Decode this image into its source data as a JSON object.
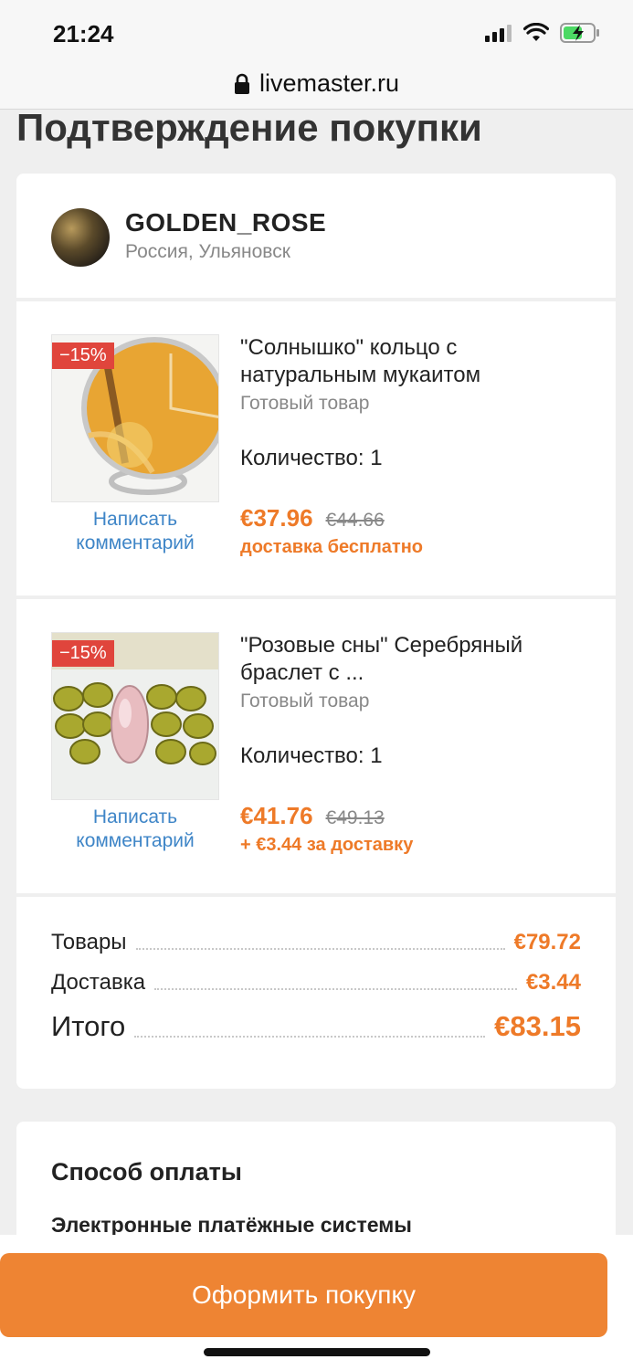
{
  "status": {
    "time": "21:24"
  },
  "browser": {
    "url": "livemaster.ru"
  },
  "page": {
    "title": "Подтверждение покупки"
  },
  "seller": {
    "name": "GOLDEN_ROSE",
    "location": "Россия, Ульяновск"
  },
  "items": [
    {
      "discount": "−15%",
      "title": "\"Солнышко\" кольцо с натуральным мукаитом",
      "type": "Готовый товар",
      "quantity": "Количество: 1",
      "price": "€37.96",
      "old_price": "€44.66",
      "delivery": "доставка бесплатно",
      "comment_link": "Написать комментарий"
    },
    {
      "discount": "−15%",
      "title": "\"Розовые сны\" Серебряный браслет с ...",
      "type": "Готовый товар",
      "quantity": "Количество: 1",
      "price": "€41.76",
      "old_price": "€49.13",
      "delivery": "+ €3.44 за доставку",
      "comment_link": "Написать комментарий"
    }
  ],
  "summary": {
    "goods_label": "Товары",
    "goods_value": "€79.72",
    "delivery_label": "Доставка",
    "delivery_value": "€3.44",
    "total_label": "Итого",
    "total_value": "€83.15"
  },
  "payment": {
    "title": "Способ оплаты",
    "method": "Электронные платёжные системы"
  },
  "checkout": {
    "button_label": "Оформить покупку"
  },
  "colors": {
    "accent": "#ee7a28",
    "link": "#3e85c7",
    "discount_badge": "#e0453c",
    "button": "#ee8433"
  }
}
